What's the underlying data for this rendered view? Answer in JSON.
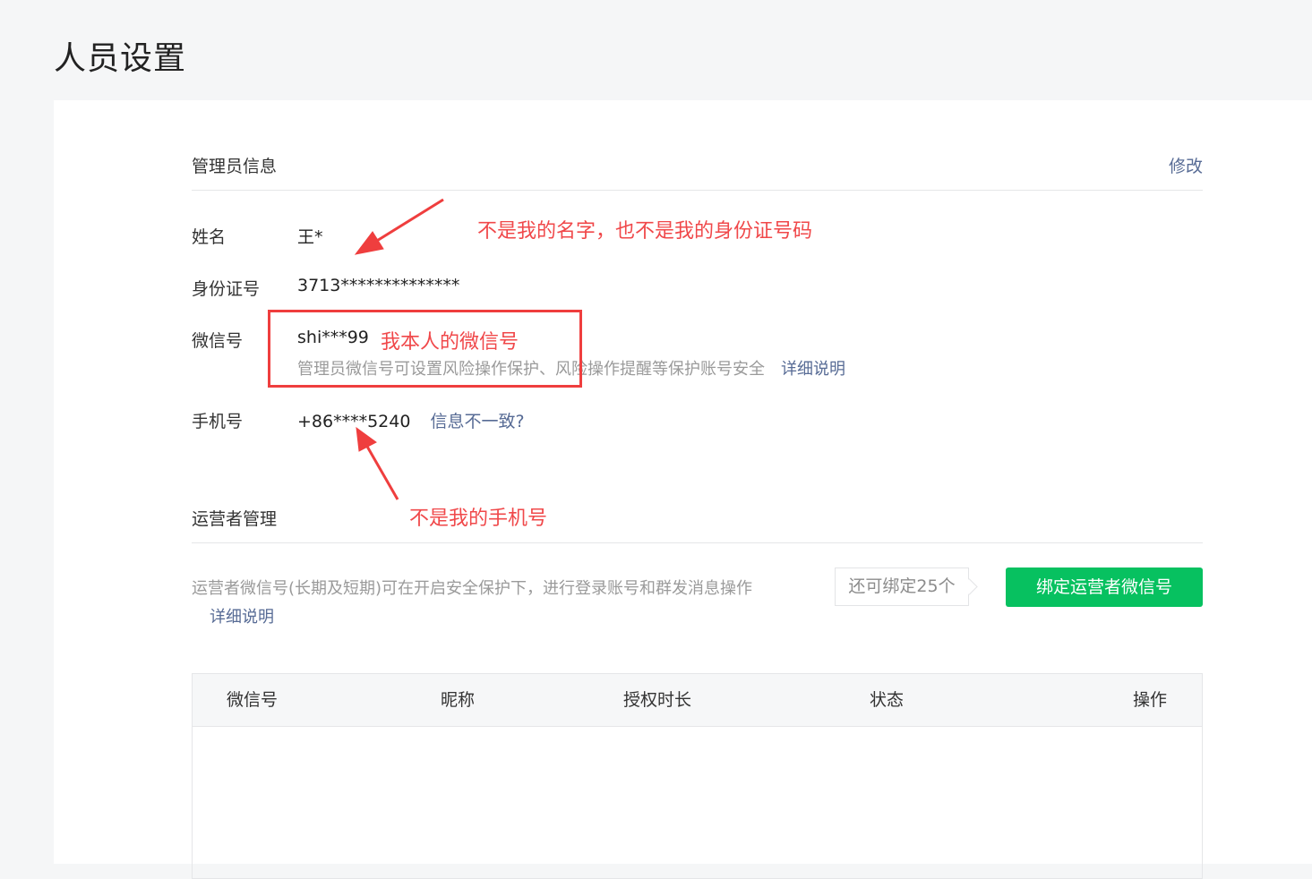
{
  "page": {
    "title": "人员设置"
  },
  "admin": {
    "section_title": "管理员信息",
    "edit_label": "修改",
    "name": {
      "label": "姓名",
      "value": "王*"
    },
    "id_card": {
      "label": "身份证号",
      "value": "3713**************"
    },
    "wechat": {
      "label": "微信号",
      "value": "shi***99",
      "hint": "管理员微信号可设置风险操作保护、风险操作提醒等保护账号安全",
      "detail_link": "详细说明"
    },
    "phone": {
      "label": "手机号",
      "value": "+86****5240",
      "mismatch_link": "信息不一致?"
    }
  },
  "operators": {
    "section_title": "运营者管理",
    "description": "运营者微信号(长期及短期)可在开启安全保护下，进行登录账号和群发消息操作",
    "detail_link": "详细说明",
    "quota": "还可绑定25个",
    "bind_button": "绑定运营者微信号",
    "table": {
      "columns": [
        "微信号",
        "昵称",
        "授权时长",
        "状态",
        "操作"
      ]
    }
  },
  "annotations": {
    "not_my_name_id": "不是我的名字，也不是我的身份证号码",
    "my_wechat": "我本人的微信号",
    "not_my_phone": "不是我的手机号",
    "color": "#f0484a"
  }
}
